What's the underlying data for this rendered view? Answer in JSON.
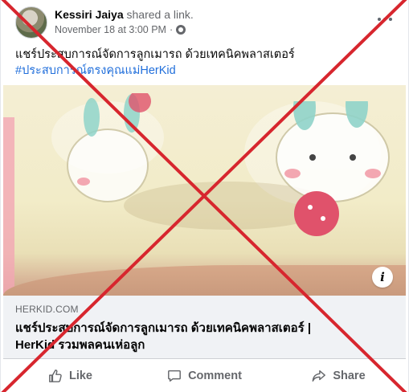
{
  "post": {
    "author": "Kessiri Jaiya",
    "action": "shared a link.",
    "timestamp": "November 18 at 3:00 PM",
    "separator": "·",
    "privacy_icon": "globe-icon",
    "text": "แชร์ประสบการณ์จัดการลูกเมารถ ด้วยเทคนิคพลาสเตอร์",
    "hashtag": "#ประสบการณ์ตรงคุณแม่HerKid"
  },
  "link_preview": {
    "domain": "HERKID.COM",
    "title_line1": "แชร์ประสบการณ์จัดการลูกเมารถ ด้วยเทคนิคพลาสเตอร์ |",
    "title_line2": "HerKid รวมพลคนเห่อลูก",
    "info_glyph": "i"
  },
  "actions": {
    "like": "Like",
    "comment": "Comment",
    "share": "Share"
  },
  "colors": {
    "overlay_cross": "#d7262e",
    "link_blue": "#216fdb",
    "muted": "#65676b"
  }
}
